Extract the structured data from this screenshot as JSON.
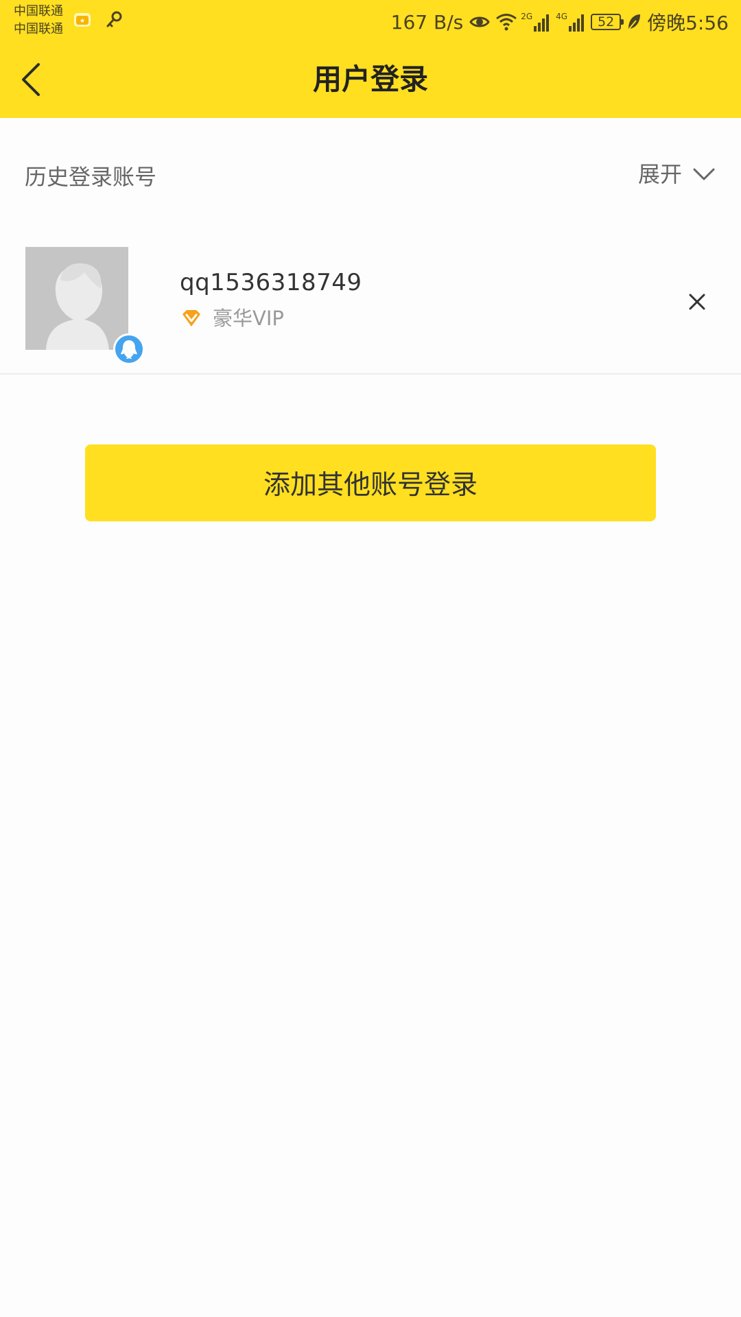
{
  "status_bar": {
    "carrier_1": "中国联通",
    "carrier_2": "中国联通",
    "speed": "167 B/s",
    "network_2g": "2G",
    "network_4g": "4G",
    "battery": "52",
    "time": "傍晚5:56",
    "icons": [
      "app-notification-icon",
      "key-icon",
      "eye-icon",
      "wifi-icon",
      "signal-icon",
      "signal-icon",
      "battery-icon",
      "leaf-icon"
    ]
  },
  "header": {
    "title": "用户登录",
    "back_icon": "chevron-left-icon"
  },
  "history": {
    "label": "历史登录账号",
    "expand_label": "展开",
    "expand_icon": "chevron-down-icon"
  },
  "account": {
    "name": "qq1536318749",
    "vip_label": "豪华VIP",
    "avatar_icon": "default-avatar-icon",
    "badge_icon": "qq-icon",
    "remove_icon": "close-icon"
  },
  "actions": {
    "add_login_label": "添加其他账号登录"
  },
  "colors": {
    "accent": "#ffdf1f",
    "text_primary": "#333333",
    "text_secondary": "#666666",
    "text_muted": "#999999",
    "qq_blue": "#44a4ef",
    "vip_orange": "#f7a21b"
  }
}
